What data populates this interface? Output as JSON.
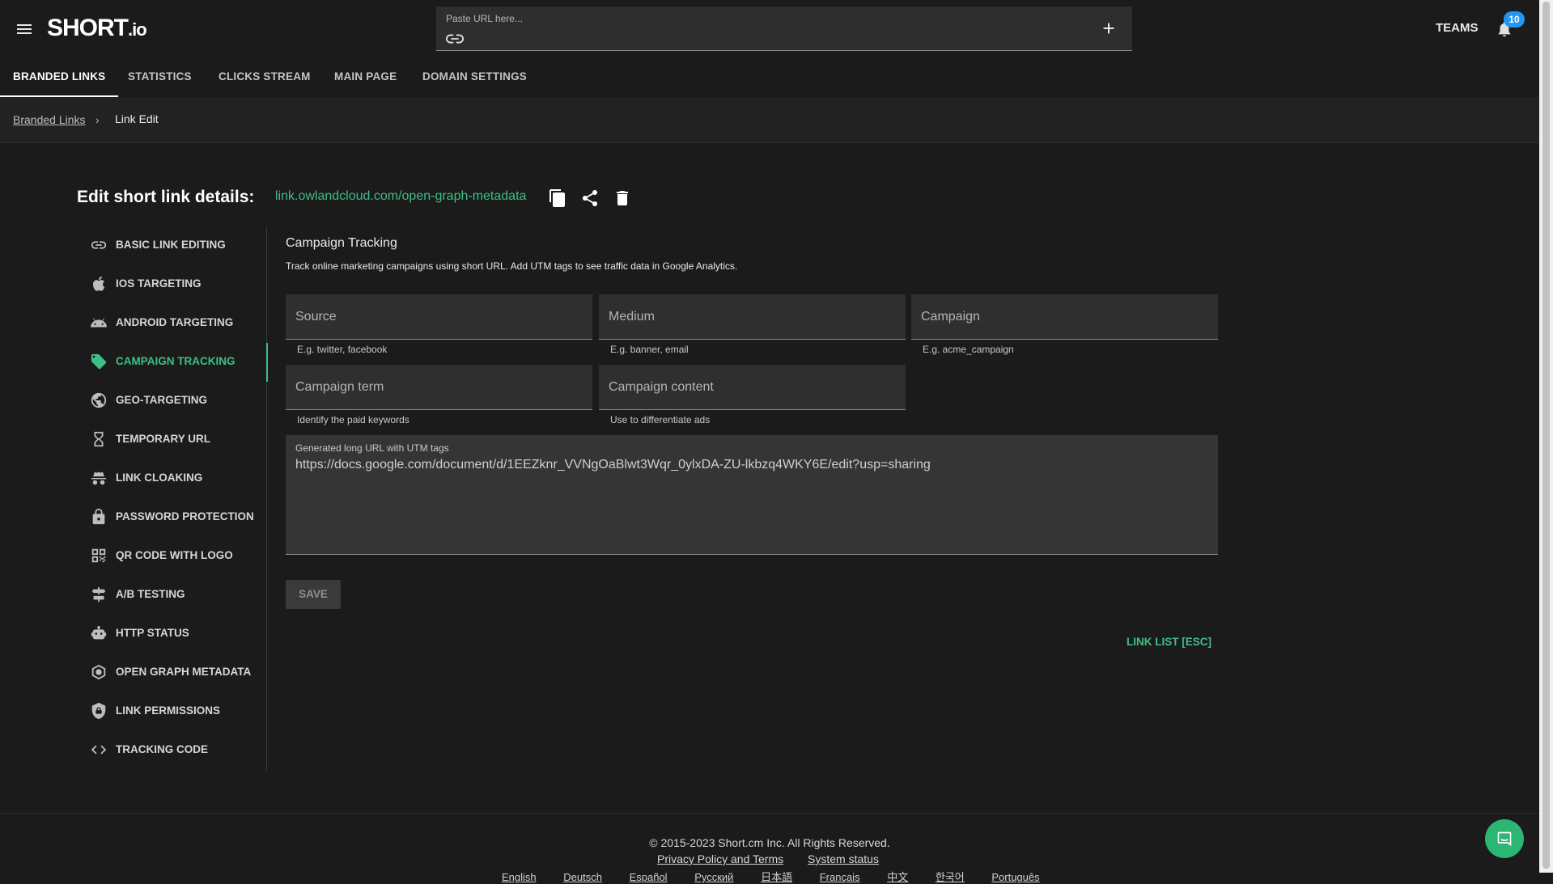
{
  "app": {
    "logo_text": "SHORT",
    "logo_suffix": ".io"
  },
  "header": {
    "url_placeholder": "Paste URL here...",
    "teams_label": "TEAMS",
    "notifications_count": "10"
  },
  "tabs": [
    {
      "label": "BRANDED LINKS",
      "active": true
    },
    {
      "label": "STATISTICS"
    },
    {
      "label": "CLICKS STREAM"
    },
    {
      "label": "MAIN PAGE"
    },
    {
      "label": "DOMAIN SETTINGS"
    }
  ],
  "breadcrumb": {
    "parent": "Branded Links",
    "separator": "›",
    "current": "Link Edit"
  },
  "link": {
    "heading": "Edit short link details:",
    "short_url": "link.owlandcloud.com/open-graph-metadata"
  },
  "sidebar": {
    "items": [
      {
        "label": "BASIC LINK EDITING",
        "icon": "link-icon"
      },
      {
        "label": "IOS TARGETING",
        "icon": "apple-icon"
      },
      {
        "label": "ANDROID TARGETING",
        "icon": "android-icon"
      },
      {
        "label": "CAMPAIGN TRACKING",
        "icon": "tag-icon",
        "active": true
      },
      {
        "label": "GEO-TARGETING",
        "icon": "globe-icon"
      },
      {
        "label": "TEMPORARY URL",
        "icon": "hourglass-icon"
      },
      {
        "label": "LINK CLOAKING",
        "icon": "incognito-icon"
      },
      {
        "label": "PASSWORD PROTECTION",
        "icon": "lock-icon"
      },
      {
        "label": "QR CODE WITH LOGO",
        "icon": "qr-code-icon"
      },
      {
        "label": "A/B TESTING",
        "icon": "signpost-icon"
      },
      {
        "label": "HTTP STATUS",
        "icon": "robot-icon"
      },
      {
        "label": "OPEN GRAPH METADATA",
        "icon": "web-icon"
      },
      {
        "label": "LINK PERMISSIONS",
        "icon": "shield-lock-icon"
      },
      {
        "label": "TRACKING CODE",
        "icon": "code-icon"
      }
    ]
  },
  "campaign": {
    "title": "Campaign Tracking",
    "description": "Track online marketing campaigns using short URL. Add UTM tags to see traffic data in Google Analytics.",
    "fields": {
      "source": {
        "placeholder": "Source",
        "hint": "E.g. twitter, facebook",
        "value": ""
      },
      "medium": {
        "placeholder": "Medium",
        "hint": "E.g. banner, email",
        "value": ""
      },
      "campaign": {
        "placeholder": "Campaign",
        "hint": "E.g. acme_campaign",
        "value": ""
      },
      "term": {
        "placeholder": "Campaign term",
        "hint": "Identify the paid keywords",
        "value": ""
      },
      "content": {
        "placeholder": "Campaign content",
        "hint": "Use to differentiate ads",
        "value": ""
      }
    },
    "generated_label": "Generated long URL with UTM tags",
    "generated_url": "https://docs.google.com/document/d/1EEZknr_VVNgOaBlwt3Wqr_0ylxDA-ZU-lkbzq4WKY6E/edit?usp=sharing",
    "save_label": "SAVE",
    "link_list_label": "LINK LIST [ESC]"
  },
  "footer": {
    "copyright": "© 2015-2023  Short.cm Inc. All Rights Reserved.",
    "privacy": "Privacy Policy and Terms",
    "status": "System status",
    "languages": [
      "English",
      "Deutsch",
      "Español",
      "Русский",
      "日本語",
      "Français",
      "中文",
      "한국어",
      "Português"
    ]
  },
  "colors": {
    "accent": "#3fbf86",
    "badge": "#2196f3",
    "background": "#1b1b1b"
  }
}
